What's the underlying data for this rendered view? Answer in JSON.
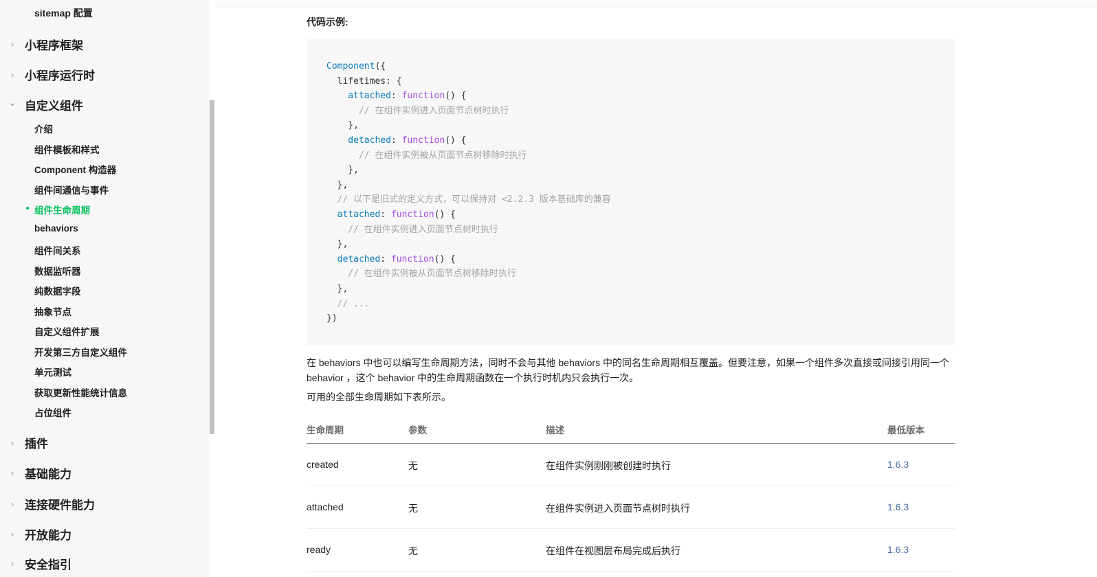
{
  "sidebar": {
    "top_item": "sitemap 配置",
    "categories_top": [
      {
        "label": "小程序框架",
        "expanded": false
      },
      {
        "label": "小程序运行时",
        "expanded": false
      },
      {
        "label": "自定义组件",
        "expanded": true
      }
    ],
    "sub_items": [
      {
        "label": "介绍",
        "active": false
      },
      {
        "label": "组件模板和样式",
        "active": false
      },
      {
        "label": "Component 构造器",
        "active": false
      },
      {
        "label": "组件间通信与事件",
        "active": false
      },
      {
        "label": "组件生命周期",
        "active": true
      },
      {
        "label": "behaviors",
        "active": false
      },
      {
        "label": "组件间关系",
        "active": false
      },
      {
        "label": "数据监听器",
        "active": false
      },
      {
        "label": "纯数据字段",
        "active": false
      },
      {
        "label": "抽象节点",
        "active": false
      },
      {
        "label": "自定义组件扩展",
        "active": false
      },
      {
        "label": "开发第三方自定义组件",
        "active": false
      },
      {
        "label": "单元测试",
        "active": false
      },
      {
        "label": "获取更新性能统计信息",
        "active": false
      },
      {
        "label": "占位组件",
        "active": false
      }
    ],
    "categories_bottom": [
      {
        "label": "插件"
      },
      {
        "label": "基础能力"
      },
      {
        "label": "连接硬件能力"
      },
      {
        "label": "开放能力"
      },
      {
        "label": "安全指引"
      }
    ],
    "chevron_right": "›",
    "chevron_down": "⌄"
  },
  "main": {
    "code_title": "代码示例:",
    "code_lines": [
      [
        [
          "fn",
          "Component"
        ],
        [
          "plain",
          "({"
        ]
      ],
      [
        [
          "plain",
          "  lifetimes: {"
        ]
      ],
      [
        [
          "prop",
          "    attached"
        ],
        [
          "plain",
          ": "
        ],
        [
          "kw",
          "function"
        ],
        [
          "plain",
          "() {"
        ]
      ],
      [
        [
          "cmt",
          "      // 在组件实例进入页面节点树时执行"
        ]
      ],
      [
        [
          "plain",
          "    },"
        ]
      ],
      [
        [
          "prop",
          "    detached"
        ],
        [
          "plain",
          ": "
        ],
        [
          "kw",
          "function"
        ],
        [
          "plain",
          "() {"
        ]
      ],
      [
        [
          "cmt",
          "      // 在组件实例被从页面节点树移除时执行"
        ]
      ],
      [
        [
          "plain",
          "    },"
        ]
      ],
      [
        [
          "plain",
          "  },"
        ]
      ],
      [
        [
          "cmt",
          "  // 以下是旧式的定义方式，可以保持对 <2.2.3 版本基础库的兼容"
        ]
      ],
      [
        [
          "prop",
          "  attached"
        ],
        [
          "plain",
          ": "
        ],
        [
          "kw",
          "function"
        ],
        [
          "plain",
          "() {"
        ]
      ],
      [
        [
          "cmt",
          "    // 在组件实例进入页面节点树时执行"
        ]
      ],
      [
        [
          "plain",
          "  },"
        ]
      ],
      [
        [
          "prop",
          "  detached"
        ],
        [
          "plain",
          ": "
        ],
        [
          "kw",
          "function"
        ],
        [
          "plain",
          "() {"
        ]
      ],
      [
        [
          "cmt",
          "    // 在组件实例被从页面节点树移除时执行"
        ]
      ],
      [
        [
          "plain",
          "  },"
        ]
      ],
      [
        [
          "cmt",
          "  // ..."
        ]
      ],
      [
        [
          "plain",
          "})"
        ]
      ]
    ],
    "para1_line1": "在 behaviors 中也可以编写生命周期方法，同时不会与其他 behaviors 中的同名生命周期相互覆盖。但要注意，如果一个组件多次直接或间接引用同一个",
    "para1_line2": "behavior ，这个 behavior 中的生命周期函数在一个执行时机内只会执行一次。",
    "para2": "可用的全部生命周期如下表所示。",
    "table": {
      "headers": [
        "生命周期",
        "参数",
        "描述",
        "最低版本"
      ],
      "rows": [
        [
          "created",
          "无",
          "在组件实例刚刚被创建时执行",
          "1.6.3"
        ],
        [
          "attached",
          "无",
          "在组件实例进入页面节点树时执行",
          "1.6.3"
        ],
        [
          "ready",
          "无",
          "在组件在视图层布局完成后执行",
          "1.6.3"
        ]
      ]
    }
  }
}
